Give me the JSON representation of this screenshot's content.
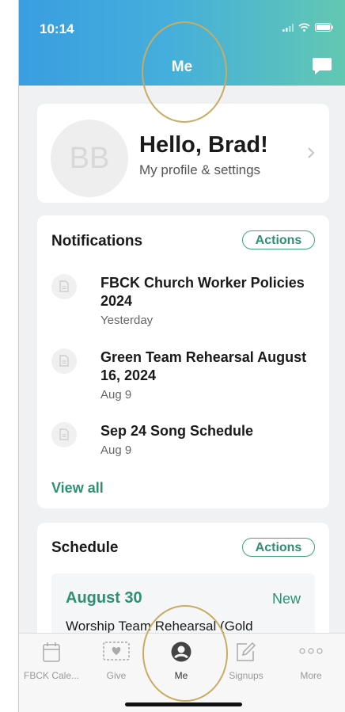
{
  "status": {
    "time": "10:14"
  },
  "header": {
    "title": "Me",
    "chat_icon": "chat-bubble-icon"
  },
  "profile": {
    "initials": "BB",
    "greeting": "Hello, Brad!",
    "subtitle": "My profile & settings"
  },
  "notifications": {
    "title": "Notifications",
    "actions_label": "Actions",
    "items": [
      {
        "title": "FBCK Church Worker Policies 2024",
        "date": "Yesterday"
      },
      {
        "title": "Green Team Rehearsal August 16, 2024",
        "date": "Aug 9"
      },
      {
        "title": "Sep 24 Song Schedule",
        "date": "Aug 9"
      }
    ],
    "view_all_label": "View all"
  },
  "schedule": {
    "title": "Schedule",
    "actions_label": "Actions",
    "event": {
      "date": "August 30",
      "badge": "New",
      "name": "Worship Team Rehearsal (Gold"
    }
  },
  "tabbar": {
    "items": [
      {
        "label": "FBCK Cale...",
        "icon": "calendar-icon",
        "active": false
      },
      {
        "label": "Give",
        "icon": "give-icon",
        "active": false
      },
      {
        "label": "Me",
        "icon": "person-icon",
        "active": true
      },
      {
        "label": "Signups",
        "icon": "signup-icon",
        "active": false
      },
      {
        "label": "More",
        "icon": "more-icon",
        "active": false
      }
    ]
  },
  "colors": {
    "accent": "#2e8f73",
    "header_start": "#3a9ee0",
    "header_end": "#62c8b2",
    "highlight_ring": "#c8ac62"
  }
}
